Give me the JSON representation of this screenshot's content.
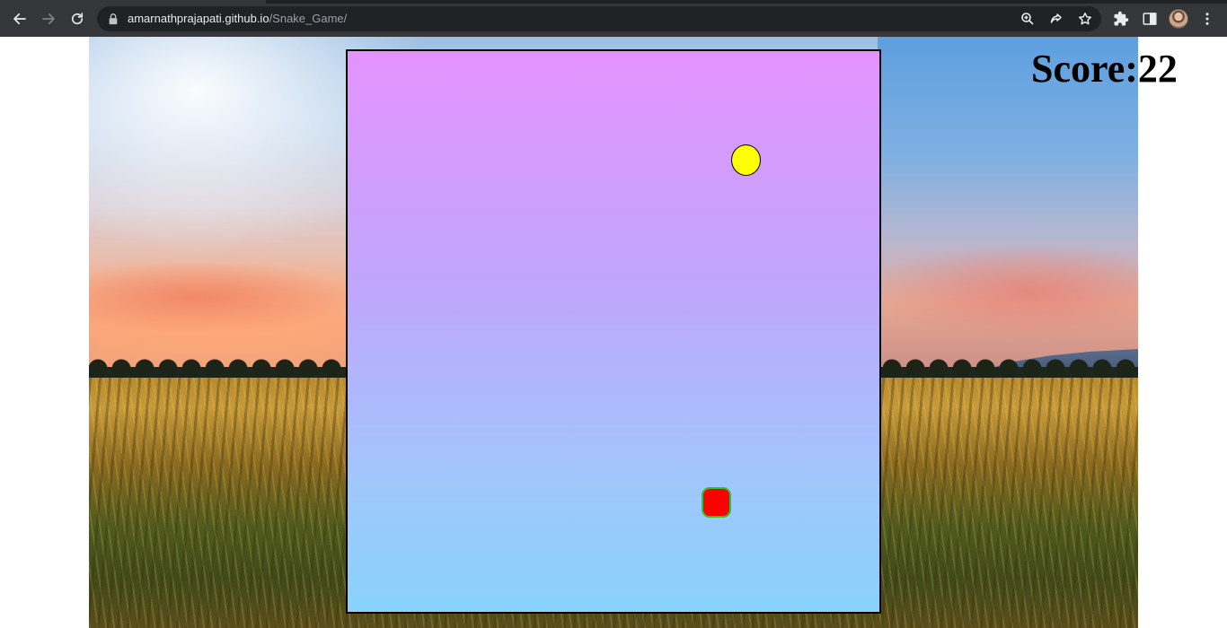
{
  "browser": {
    "url_host": "amarnathprajapati.github.io",
    "url_path": "/Snake_Game/",
    "toolbar_icons": [
      "back-icon",
      "forward-icon",
      "reload-icon",
      "lock-icon",
      "zoom-icon",
      "share-icon",
      "star-icon",
      "extensions-icon",
      "side-panel-icon",
      "profile-avatar",
      "menu-icon"
    ]
  },
  "game": {
    "score_label": "Score:",
    "score_value": "22",
    "food_color": "#ffff00",
    "snake_head_color": "#ff0000",
    "snake_outline_color": "#2fc42f",
    "board_gradient": [
      "#e592fd",
      "#88d2fb"
    ]
  }
}
